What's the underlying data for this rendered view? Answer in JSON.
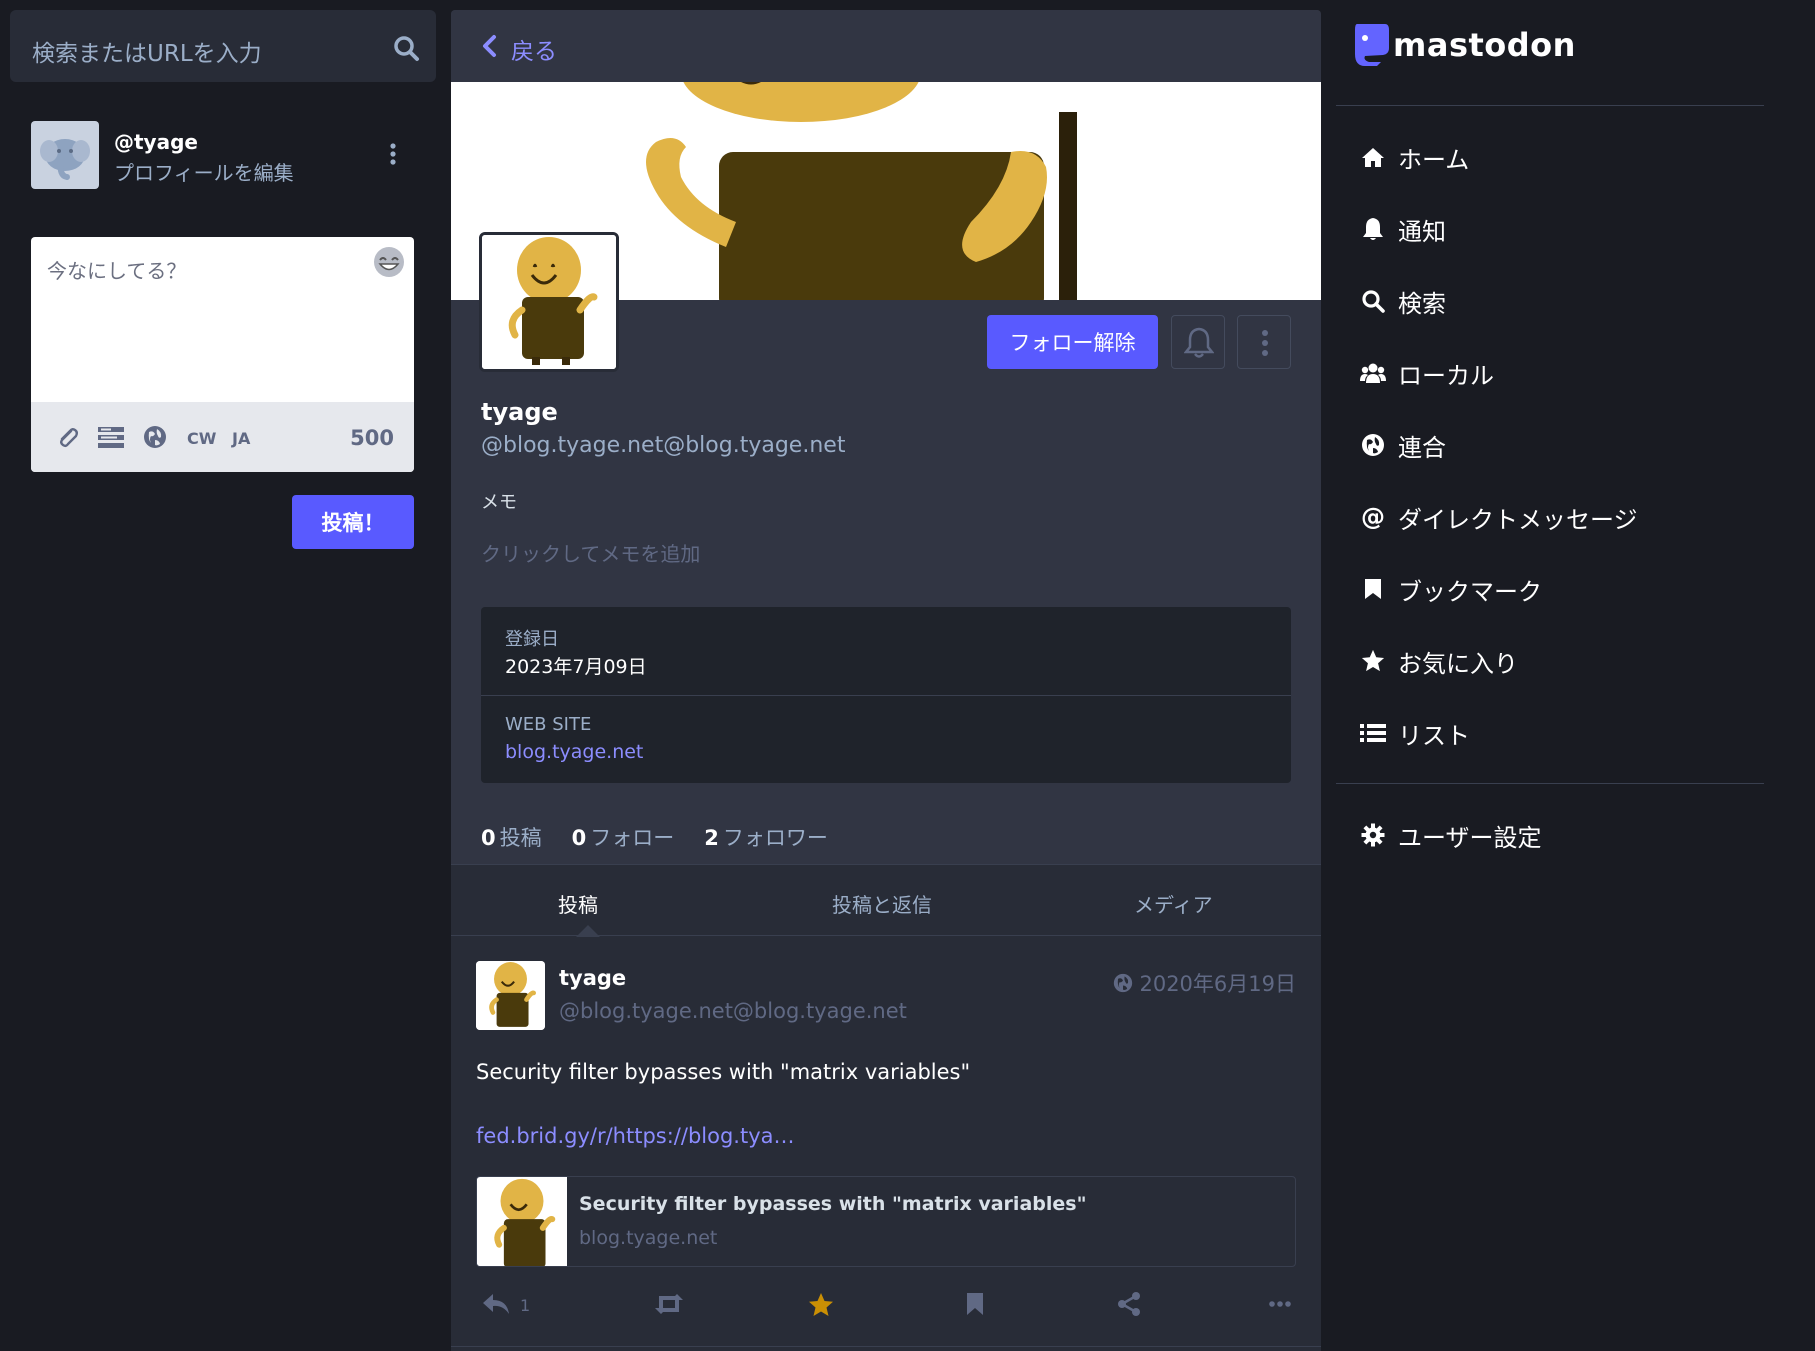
{
  "search": {
    "placeholder": "検索またはURLを入力"
  },
  "me": {
    "handle": "@tyage",
    "edit_label": "プロフィールを編集"
  },
  "compose": {
    "placeholder": "今なにしてる？",
    "cw_label": "CW",
    "lang_label": "JA",
    "char_count": "500",
    "post_label": "投稿！"
  },
  "column_header": {
    "back_label": "戻る"
  },
  "profile": {
    "unfollow_label": "フォロー解除",
    "display_name": "tyage",
    "account": "@blog.tyage.net@blog.tyage.net",
    "memo_label": "メモ",
    "memo_placeholder": "クリックしてメモを追加",
    "fields": [
      {
        "name": "登録日",
        "value": "2023年7月09日"
      },
      {
        "name": "WEB SITE",
        "value": "blog.tyage.net"
      }
    ],
    "counts": {
      "posts": "0",
      "posts_label": "投稿",
      "following": "0",
      "following_label": "フォロー",
      "followers": "2",
      "followers_label": "フォロワー"
    }
  },
  "tabs": [
    "投稿",
    "投稿と返信",
    "メディア"
  ],
  "status": {
    "display_name": "tyage",
    "account": "@blog.tyage.net@blog.tyage.net",
    "date": "2020年6月19日",
    "text": "Security filter bypasses with \"matrix variables\"",
    "link": "fed.brid.gy/r/https://blog.tya…",
    "card_title": "Security filter bypasses with \"matrix variables\"",
    "card_domain": "blog.tyage.net",
    "reply_count": "1"
  },
  "brand": {
    "name": "mastodon"
  },
  "nav": {
    "home": "ホーム",
    "notifications": "通知",
    "search": "検索",
    "local": "ローカル",
    "federated": "連合",
    "direct": "ダイレクトメッセージ",
    "bookmarks": "ブックマーク",
    "favourites": "お気に入り",
    "lists": "リスト",
    "settings": "ユーザー設定"
  },
  "colors": {
    "background": "#191b22",
    "panel": "#282c37",
    "accent": "#595aff",
    "link": "#8c8dff",
    "favourite": "#ca8f04"
  }
}
